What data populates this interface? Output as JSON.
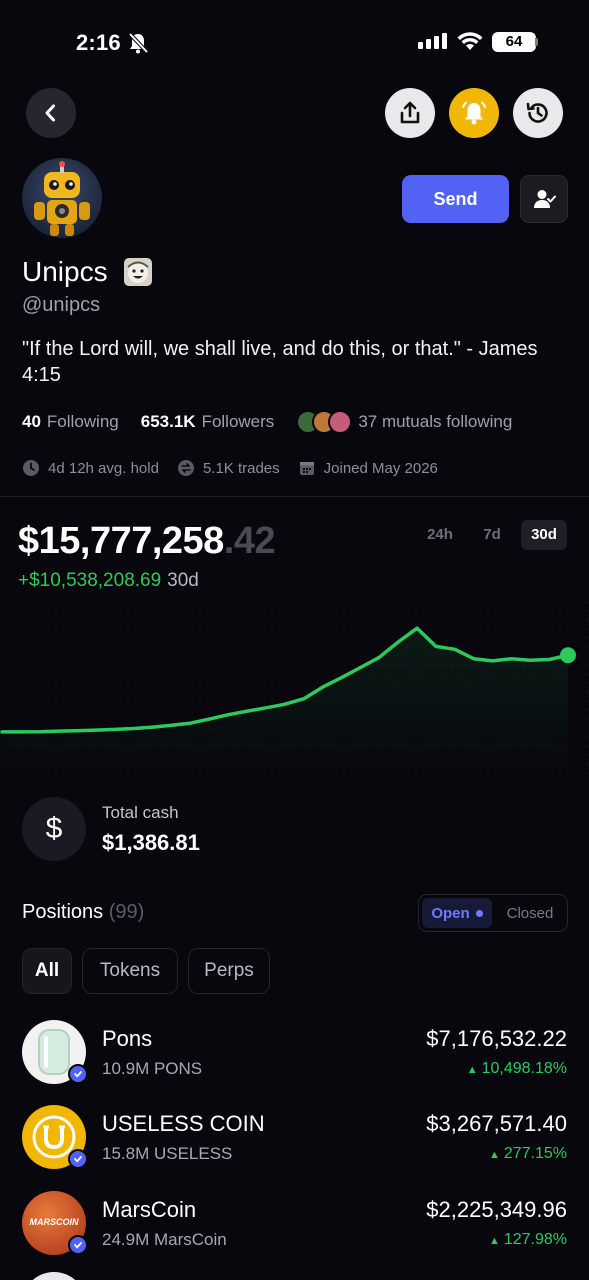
{
  "status_bar": {
    "time": "2:16",
    "battery": "64"
  },
  "profile": {
    "name": "Unipcs",
    "handle": "@unipcs",
    "bio": "\"If the Lord will, we shall live, and do this, or that.\" - James 4:15",
    "send_label": "Send",
    "following_count": "40",
    "following_label": "Following",
    "followers_count": "653.1K",
    "followers_label": "Followers",
    "mutuals_text": "37 mutuals following",
    "avg_hold": "4d 12h avg. hold",
    "trades": "5.1K trades",
    "joined": "Joined May 2026"
  },
  "portfolio": {
    "value_main": "$15,777,258",
    "value_cents": ".42",
    "change": "+$10,538,208.69",
    "change_period": "30d",
    "timeframes": [
      "24h",
      "7d",
      "30d"
    ],
    "selected_timeframe": "30d"
  },
  "chart_data": {
    "type": "line",
    "title": "",
    "xlabel": "",
    "ylabel": "",
    "grid": false,
    "legend": "none",
    "x": [
      0,
      1,
      2,
      3,
      4,
      5,
      6,
      7,
      8,
      9,
      10,
      11,
      12,
      13,
      14,
      15,
      16,
      17,
      18,
      19,
      20,
      21,
      22,
      23,
      24,
      25,
      26,
      27,
      28,
      29,
      30
    ],
    "values": [
      5.24,
      5.24,
      5.25,
      5.35,
      5.4,
      5.48,
      5.58,
      5.7,
      5.9,
      6.15,
      6.45,
      7.0,
      7.6,
      8.1,
      8.55,
      9.05,
      9.8,
      11.4,
      12.7,
      14.1,
      15.5,
      17.6,
      19.5,
      17.0,
      16.6,
      15.3,
      15.0,
      15.3,
      15.1,
      15.2,
      15.78
    ],
    "ylim": [
      0,
      22
    ],
    "color": "#2ec95c"
  },
  "cash": {
    "label": "Total cash",
    "value": "$1,386.81",
    "icon": "dollar-icon"
  },
  "positions": {
    "title": "Positions",
    "count": "(99)",
    "open_label": "Open",
    "closed_label": "Closed",
    "filters": [
      "All",
      "Tokens",
      "Perps"
    ],
    "items": [
      {
        "name": "Pons",
        "amount": "10.9M PONS",
        "value": "$7,176,532.22",
        "change": "10,498.18%"
      },
      {
        "name": "USELESS COIN",
        "amount": "15.8M USELESS",
        "value": "$3,267,571.40",
        "change": "277.15%"
      },
      {
        "name": "MarsCoin",
        "amount": "24.9M MarsCoin",
        "value": "$2,225,349.96",
        "change": "127.98%",
        "logo_text": "MARSCOIN"
      }
    ]
  },
  "colors": {
    "accent": "#5262f5",
    "positive": "#2ec95c",
    "alert": "#f2b705"
  }
}
